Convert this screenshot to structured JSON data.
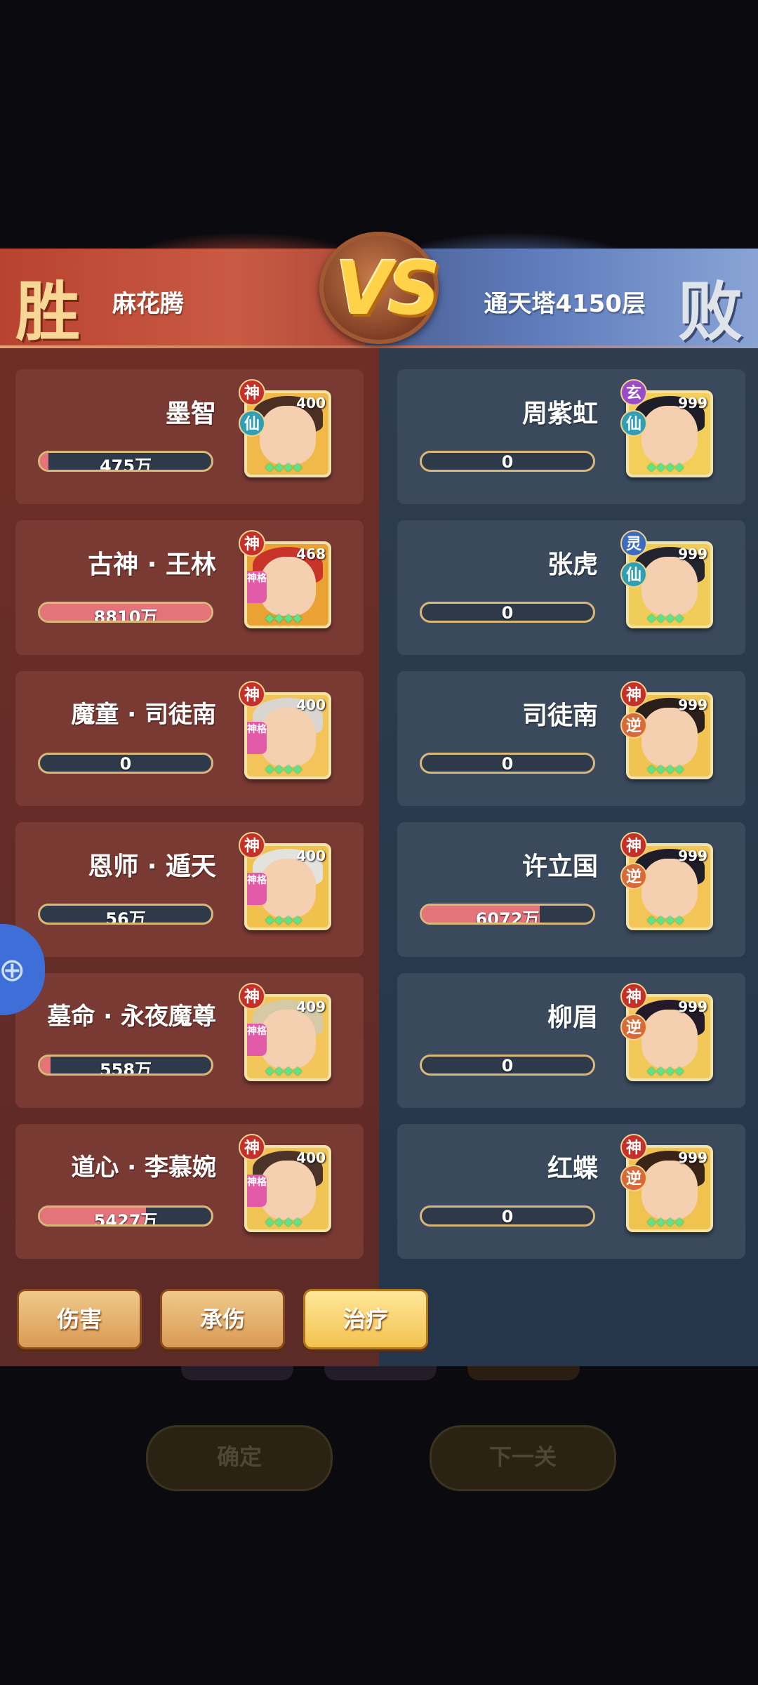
{
  "header": {
    "left_result": "胜",
    "left_name": "麻花腾",
    "center": "VS",
    "right_name": "通天塔4150层",
    "right_result": "败"
  },
  "left_team": [
    {
      "name": "墨智",
      "level": "400",
      "badge_top": "神",
      "badge_second": "仙",
      "value": "475万",
      "fill_pct": 5,
      "shenge": false
    },
    {
      "name": "古神 · 王林",
      "level": "468",
      "badge_top": "神",
      "badge_second": "",
      "value": "8810万",
      "fill_pct": 100,
      "shenge": true
    },
    {
      "name": "魔童 · 司徒南",
      "level": "400",
      "badge_top": "神",
      "badge_second": "",
      "value": "0",
      "fill_pct": 0,
      "shenge": true
    },
    {
      "name": "恩师 · 遁天",
      "level": "400",
      "badge_top": "神",
      "badge_second": "",
      "value": "56万",
      "fill_pct": 0,
      "shenge": true
    },
    {
      "name": "墓命 · 永夜魔尊",
      "level": "409",
      "badge_top": "神",
      "badge_second": "",
      "value": "558万",
      "fill_pct": 6,
      "shenge": true
    },
    {
      "name": "道心 · 李慕婉",
      "level": "400",
      "badge_top": "神",
      "badge_second": "",
      "value": "5427万",
      "fill_pct": 62,
      "shenge": true
    }
  ],
  "right_team": [
    {
      "name": "周紫虹",
      "level": "999",
      "badge_top": "玄",
      "badge_second": "仙",
      "value": "0",
      "fill_pct": 0
    },
    {
      "name": "张虎",
      "level": "999",
      "badge_top": "灵",
      "badge_second": "仙",
      "value": "0",
      "fill_pct": 0
    },
    {
      "name": "司徒南",
      "level": "999",
      "badge_top": "神",
      "badge_second": "逆",
      "value": "0",
      "fill_pct": 0
    },
    {
      "name": "许立国",
      "level": "999",
      "badge_top": "神",
      "badge_second": "逆",
      "value": "6072万",
      "fill_pct": 69
    },
    {
      "name": "柳眉",
      "level": "999",
      "badge_top": "神",
      "badge_second": "逆",
      "value": "0",
      "fill_pct": 0
    },
    {
      "name": "红蝶",
      "level": "999",
      "badge_top": "神",
      "badge_second": "逆",
      "value": "0",
      "fill_pct": 0
    }
  ],
  "shenge_label": "神格",
  "gems": "◆◆◆◆",
  "tabs": {
    "damage": "伤害",
    "taken": "承伤",
    "heal": "治疗",
    "active": "heal"
  },
  "background_buttons": {
    "confirm": "确定",
    "next": "下一关"
  },
  "colors": {
    "win": "#f7d796",
    "bar_fill": "#e5737a",
    "left_panel": "#5c2a27",
    "right_panel": "#25354a"
  }
}
